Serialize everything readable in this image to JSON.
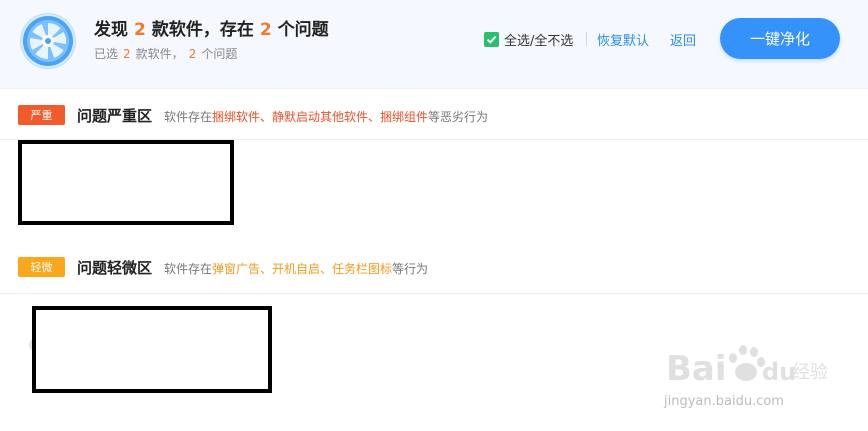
{
  "header": {
    "title": {
      "prefix": "发现",
      "software_count": "2",
      "middle": "款软件，存在",
      "issue_count": "2",
      "suffix": "个问题"
    },
    "subtitle": {
      "prefix": "已选",
      "software_count": "2",
      "middle": "款软件，",
      "issue_count": "2",
      "suffix": "个问题"
    },
    "select_all_label": "全选/全不选",
    "restore_default_label": "恢复默认",
    "back_label": "返回",
    "clean_button_label": "一键净化",
    "accent_color": "#3592fa",
    "checkbox_color": "#28c06a",
    "icons": [
      "fan-logo-icon",
      "checkbox-checked-icon"
    ]
  },
  "sections": [
    {
      "badge": "严重",
      "badge_color": "#f35a2a",
      "title": "问题严重区",
      "desc_prefix": "软件存在",
      "desc_highlight": "捆绑软件、静默启动其他软件、捆绑组件",
      "desc_suffix": "等恶劣行为",
      "highlight_color": "#e9512b"
    },
    {
      "badge": "轻微",
      "badge_color": "#fba71b",
      "title": "问题轻微区",
      "desc_prefix": "软件存在",
      "desc_highlight": "弹窗广告、开机自启、任务栏图标",
      "desc_suffix": "等行为",
      "highlight_color": "#f39a1a"
    }
  ],
  "watermark": {
    "brand": "Bai du 经验",
    "url": "jingyan.baidu.com"
  }
}
